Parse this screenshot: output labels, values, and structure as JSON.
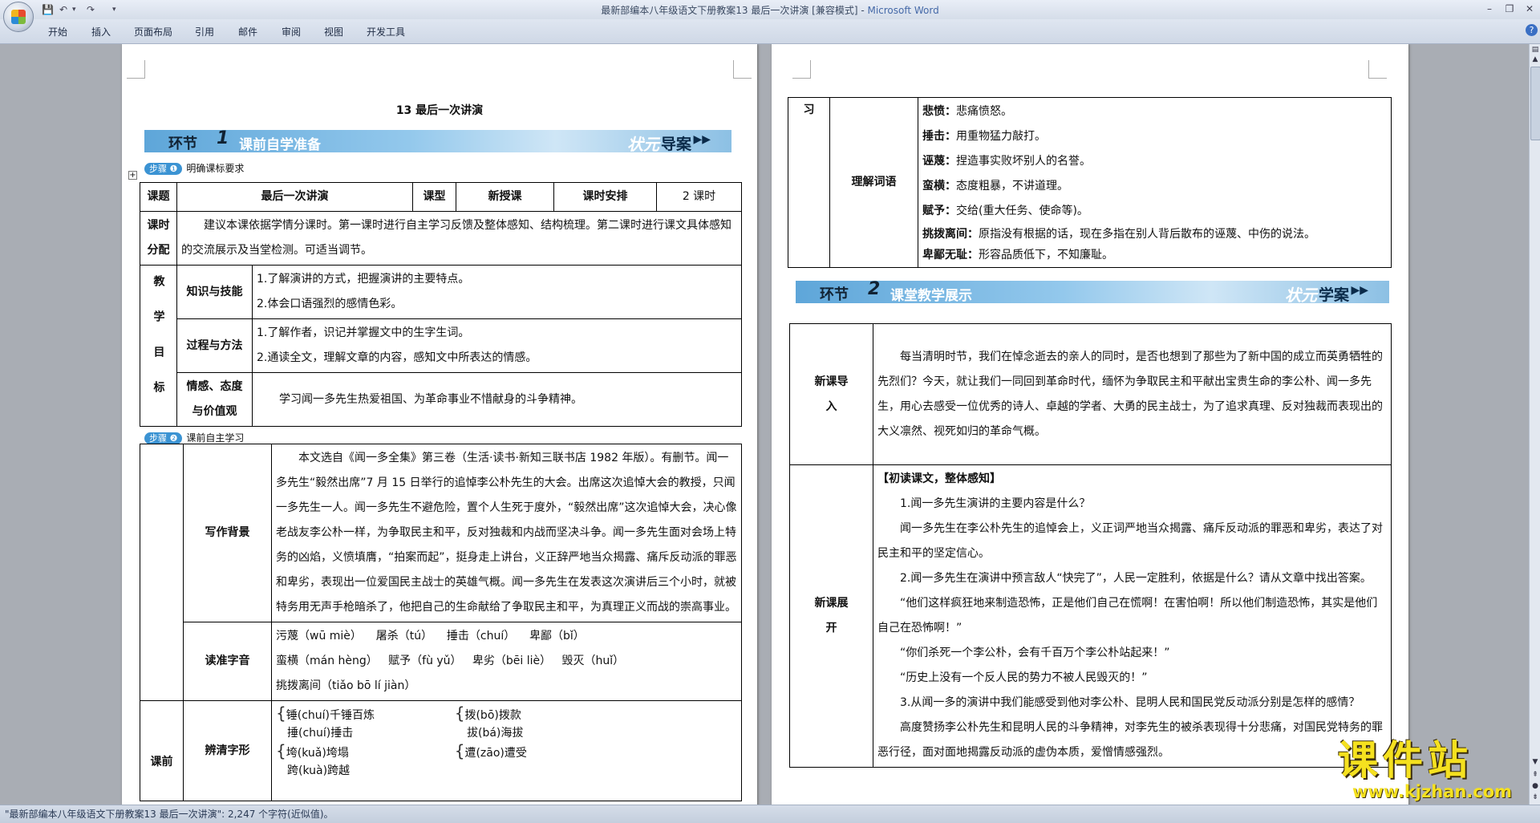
{
  "window": {
    "title": "最新部编本八年级语文下册教案13 最后一次讲演 [兼容模式] - ",
    "app_name": "Microsoft Word"
  },
  "ribbon_tabs": [
    "开始",
    "插入",
    "页面布局",
    "引用",
    "邮件",
    "审阅",
    "视图",
    "开发工具"
  ],
  "status_bar": {
    "text": "\"最新部编本八年级语文下册教案13 最后一次讲演\": 2,247 个字符(近似值)。"
  },
  "page1": {
    "lesson_title": "13  最后一次讲演",
    "banner1": {
      "huanjie": "环节",
      "num": "1",
      "name": "课前自学准备",
      "zy": "状元",
      "tag": "导案",
      "arrows": "▶▶"
    },
    "step1": {
      "pill": "步骤 ❶",
      "label": "明确课标要求"
    },
    "step2": {
      "pill": "步骤 ❷",
      "label": "课前自主学习"
    },
    "t1": {
      "h_keti": "课题",
      "keti": "最后一次讲演",
      "h_kexing": "课型",
      "kexing": "新授课",
      "h_anpai": "课时安排",
      "anpai": "2 课时",
      "h_fenpei": "课时分配",
      "fenpei": "建议本课依据学情分课时。第一课时进行自主学习反馈及整体感知、结构梳理。第二课时进行课文具体感知的交流展示及当堂检测。可适当调节。",
      "h_mubiao": "教学目标",
      "zs_label": "知识与技能",
      "zs1": "1.了解演讲的方式，把握演讲的主要特点。",
      "zs2": "2.体会口语强烈的感情色彩。",
      "gc_label": "过程与方法",
      "gc1": "1.了解作者，识记并掌握文中的生字生词。",
      "gc2": "2.通读全文，理解文章的内容，感知文中所表达的情感。",
      "qg_label": "情感、态度与价值观",
      "qg": "学习闻一多先生热爱祖国、为革命事业不惜献身的斗争精神。"
    },
    "t2": {
      "bj_label": "写作背景",
      "bj": "本文选自《闻一多全集》第三卷（生活·读书·新知三联书店 1982 年版）。有删节。闻一多先生“毅然出席”7 月 15 日举行的追悼李公朴先生的大会。出席这次追悼大会的教授，只闻一多先生一人。闻一多先生不避危险，置个人生死于度外，“毅然出席”这次追悼大会，决心像老战友李公朴一样，为争取民主和平，反对独裁和内战而坚决斗争。闻一多先生面对会场上特务的凶焰，义愤填膺，“拍案而起”，挺身走上讲台，义正辞严地当众揭露、痛斥反动派的罪恶和卑劣，表现出一位爱国民主战士的英雄气概。闻一多先生在发表这次演讲后三个小时，就被特务用无声手枪暗杀了，他把自己的生命献给了争取民主和平，为真理正义而战的崇高事业。",
      "dz_label": "读准字音",
      "dz_line1": "污蔑（wū miè）    屠杀（tú）    捶击（chuí）    卑鄙（bǐ）",
      "dz_line2": "蛮横（mán hèng）   赋予（fù yǔ）   卑劣（bēi liè）   毁灭（huǐ）",
      "dz_line3": "挑拨离间（tiǎo bō lí jiàn）",
      "kq_label": "课前",
      "bq_label": "辨清字形",
      "bq_a1": "锤(chuí)千锤百炼",
      "bq_a2": "捶(chuí)捶击",
      "bq_b1": "拨(bō)拨款",
      "bq_b2": "拔(bá)海拔",
      "bq_c1": "垮(kuǎ)垮塌",
      "bq_c2": "跨(kuà)跨越",
      "bq_d1": "遭(zāo)遭受"
    }
  },
  "page2": {
    "vocab": {
      "left_label": "习",
      "label": "理解词语",
      "items": [
        {
          "term": "悲愤：",
          "def": "悲痛愤怒。"
        },
        {
          "term": "捶击：",
          "def": "用重物猛力敲打。"
        },
        {
          "term": "诬蔑：",
          "def": "捏造事实败坏别人的名誉。"
        },
        {
          "term": "蛮横：",
          "def": "态度粗暴，不讲道理。"
        },
        {
          "term": "赋予：",
          "def": "交给(重大任务、使命等)。"
        },
        {
          "term": "挑拨离间：",
          "def": "原指没有根据的话，现在多指在别人背后散布的诬蔑、中伤的说法。"
        },
        {
          "term": "卑鄙无耻：",
          "def": "形容品质低下，不知廉耻。"
        }
      ]
    },
    "banner2": {
      "huanjie": "环节",
      "num": "2",
      "name": "课堂教学展示",
      "zy": "状元",
      "tag": "学案",
      "arrows": "▶▶"
    },
    "intro": {
      "label": "新课导入",
      "text": "每当清明时节，我们在悼念逝去的亲人的同时，是否也想到了那些为了新中国的成立而英勇牺牲的先烈们？今天，就让我们一同回到革命时代，缅怀为争取民主和平献出宝贵生命的李公朴、闻一多先生，用心去感受一位优秀的诗人、卓越的学者、大勇的民主战士，为了追求真理、反对独裁而表现出的大义凛然、视死如归的革命气概。"
    },
    "expand": {
      "label": "新课展开",
      "heading": "【初读课文，整体感知】",
      "q1": "1.闻一多先生演讲的主要内容是什么？",
      "a1": "闻一多先生在李公朴先生的追悼会上，义正词严地当众揭露、痛斥反动派的罪恶和卑劣，表达了对民主和平的坚定信心。",
      "q2": "2.闻一多先生在演讲中预言敌人“快完了”，人民一定胜利，依据是什么？请从文章中找出答案。",
      "quote1": "“他们这样疯狂地来制造恐怖，正是他们自己在慌啊！在害怕啊！所以他们制造恐怖，其实是他们自己在恐怖啊！”",
      "quote2": "“你们杀死一个李公朴，会有千百万个李公朴站起来！”",
      "quote3": "“历史上没有一个反人民的势力不被人民毁灭的！”",
      "q3": "3.从闻一多的演讲中我们能感受到他对李公朴、昆明人民和国民党反动派分别是怎样的感情？",
      "a3": "高度赞扬李公朴先生和昆明人民的斗争精神，对李先生的被杀表现得十分悲痛，对国民党特务的罪恶行径，面对面地揭露反动派的虚伪本质，爱憎情感强烈。"
    }
  },
  "watermark": {
    "big": "课件站",
    "url": "www.kjzhan.com"
  }
}
